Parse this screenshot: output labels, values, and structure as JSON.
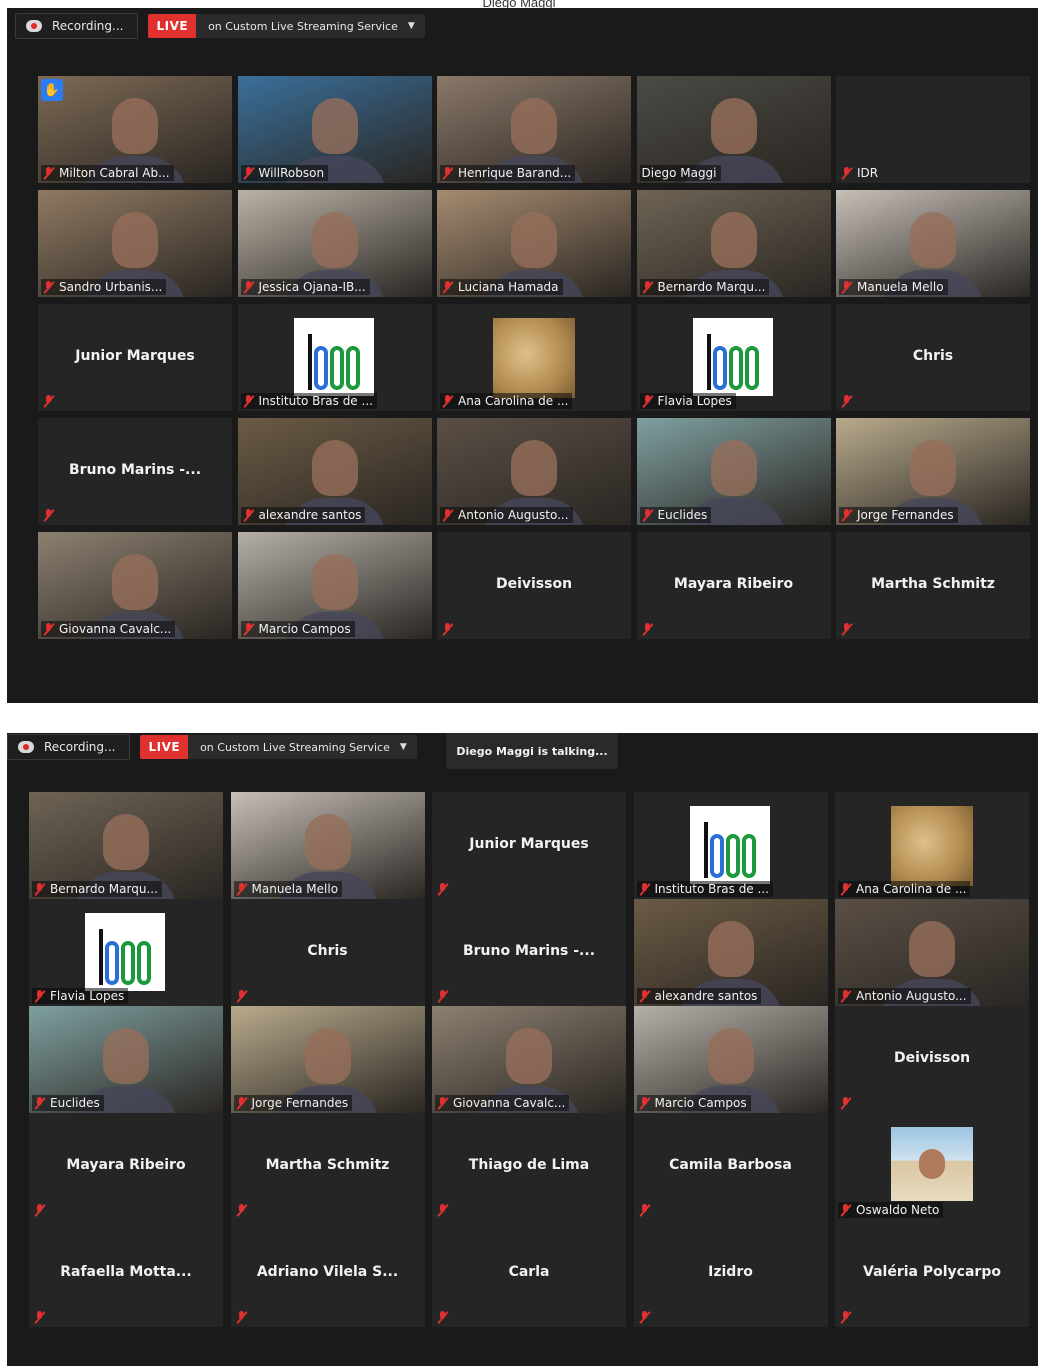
{
  "caption": "Diego Maggi",
  "screenshot_1": {
    "toolbar": {
      "recording_label": "Recording...",
      "live_badge": "LIVE",
      "streaming_service": "on Custom Live Streaming Service",
      "dropdown_caret": "▼"
    },
    "tiles": [
      {
        "name": "Milton Cabral Ab...",
        "kind": "video",
        "hand_raised": true,
        "bg": "#7d6a55"
      },
      {
        "name": "WillRobson",
        "kind": "video",
        "bg": "#3a6f9a"
      },
      {
        "name": "Henrique Barand...",
        "kind": "video",
        "bg": "#8a7868"
      },
      {
        "name": "Diego Maggi",
        "kind": "video",
        "active_speaker": true,
        "bg": "#4b4a44"
      },
      {
        "name": "IDR",
        "kind": "name_only_corner"
      },
      {
        "name": "Sandro Urbanis...",
        "kind": "video",
        "bg": "#8f7a62"
      },
      {
        "name": "Jessica Ojana-IB...",
        "kind": "video",
        "bg": "#b9b2a6"
      },
      {
        "name": "Luciana Hamada",
        "kind": "video",
        "bg": "#a58b70"
      },
      {
        "name": "Bernardo Marqu...",
        "kind": "video",
        "bg": "#6e6455"
      },
      {
        "name": "Manuela Mello",
        "kind": "video",
        "bg": "#c7bfb8"
      },
      {
        "name": "Junior Marques",
        "kind": "name"
      },
      {
        "name": "Instituto Bras de ...",
        "kind": "logo"
      },
      {
        "name": "Ana Carolina de ...",
        "kind": "map"
      },
      {
        "name": "Flavia Lopes",
        "kind": "logo"
      },
      {
        "name": "Chris",
        "kind": "name"
      },
      {
        "name": "Bruno Marins -...",
        "kind": "name"
      },
      {
        "name": "alexandre santos",
        "kind": "video",
        "bg": "#6b5b45"
      },
      {
        "name": "Antonio Augusto...",
        "kind": "video",
        "bg": "#5a4f46"
      },
      {
        "name": "Euclides",
        "kind": "video",
        "bg": "#7fa0a0"
      },
      {
        "name": "Jorge Fernandes",
        "kind": "video",
        "bg": "#b8aa8c"
      },
      {
        "name": "Giovanna Cavalc...",
        "kind": "video",
        "bg": "#8c8070"
      },
      {
        "name": "Marcio Campos",
        "kind": "video",
        "bg": "#b5b0a8"
      },
      {
        "name": "Deivisson",
        "kind": "name"
      },
      {
        "name": "Mayara Ribeiro",
        "kind": "name"
      },
      {
        "name": "Martha Schmitz",
        "kind": "name"
      }
    ]
  },
  "screenshot_2": {
    "toolbar": {
      "recording_label": "Recording...",
      "live_badge": "LIVE",
      "streaming_service": "on Custom Live Streaming Service",
      "dropdown_caret": "▼"
    },
    "talking_indicator": "Diego Maggi is talking...",
    "tiles": [
      {
        "name": "Bernardo Marqu...",
        "kind": "video",
        "bg": "#6e6455"
      },
      {
        "name": "Manuela Mello",
        "kind": "video",
        "bg": "#c7bfb8"
      },
      {
        "name": "Junior Marques",
        "kind": "name"
      },
      {
        "name": "Instituto Bras de ...",
        "kind": "logo"
      },
      {
        "name": "Ana Carolina de ...",
        "kind": "map"
      },
      {
        "name": "Flavia Lopes",
        "kind": "logo"
      },
      {
        "name": "Chris",
        "kind": "name"
      },
      {
        "name": "Bruno Marins -...",
        "kind": "name"
      },
      {
        "name": "alexandre santos",
        "kind": "video",
        "bg": "#6b5b45"
      },
      {
        "name": "Antonio Augusto...",
        "kind": "video",
        "bg": "#5a4f46"
      },
      {
        "name": "Euclides",
        "kind": "video",
        "bg": "#7fa0a0"
      },
      {
        "name": "Jorge Fernandes",
        "kind": "video",
        "bg": "#b8aa8c"
      },
      {
        "name": "Giovanna Cavalc...",
        "kind": "video",
        "bg": "#8c8070"
      },
      {
        "name": "Marcio Campos",
        "kind": "video",
        "bg": "#b5b0a8"
      },
      {
        "name": "Deivisson",
        "kind": "name"
      },
      {
        "name": "Mayara Ribeiro",
        "kind": "name"
      },
      {
        "name": "Martha Schmitz",
        "kind": "name"
      },
      {
        "name": "Thiago de Lima",
        "kind": "name"
      },
      {
        "name": "Camila Barbosa",
        "kind": "name"
      },
      {
        "name": "Oswaldo Neto",
        "kind": "photo"
      },
      {
        "name": "Rafaella Motta...",
        "kind": "name"
      },
      {
        "name": "Adriano Vilela S...",
        "kind": "name"
      },
      {
        "name": "Carla",
        "kind": "name"
      },
      {
        "name": "Izidro",
        "kind": "name"
      },
      {
        "name": "Valéria Polycarpo",
        "kind": "name"
      }
    ]
  },
  "colors": {
    "background": "#1a1a1a",
    "tile": "#252525",
    "live_red": "#e0312f",
    "active_speaker_border": "#d6e27a",
    "muted_mic": "#e03030",
    "raised_hand": "#2a7df5"
  },
  "icons": [
    "record-icon",
    "muted-mic-icon",
    "raised-hand-icon",
    "chevron-down-icon"
  ]
}
